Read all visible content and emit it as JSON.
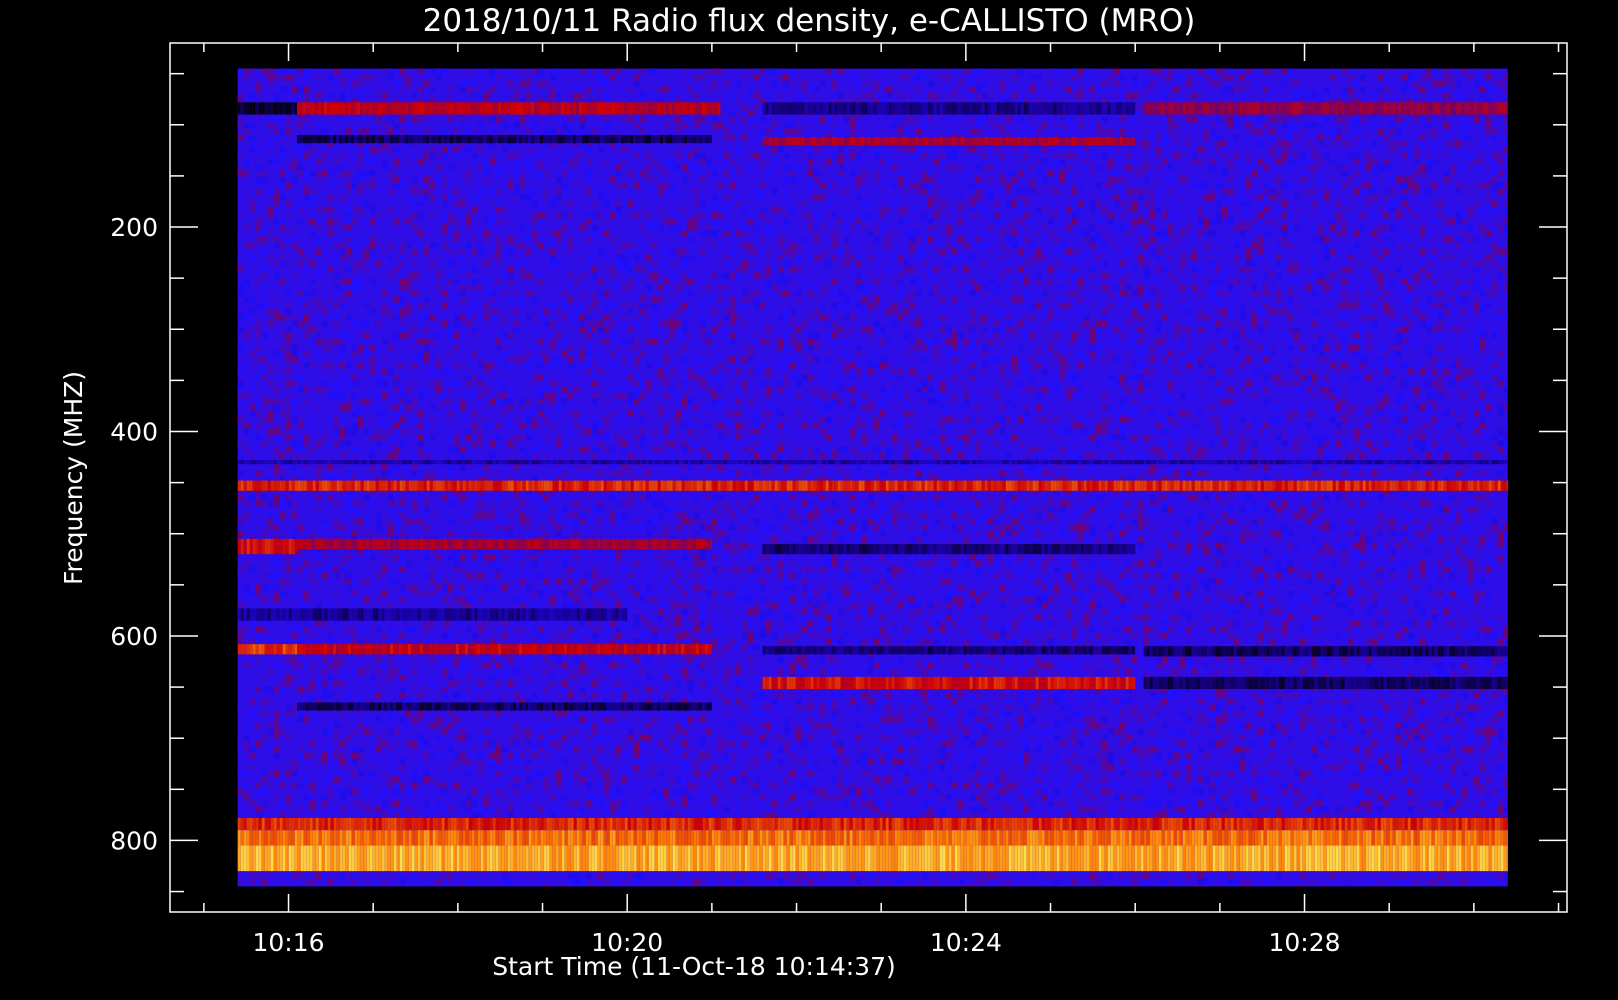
{
  "chart_data": {
    "type": "heatmap",
    "title": "2018/10/11  Radio flux density, e-CALLISTO (MRO)",
    "xlabel": "Start Time (11-Oct-18 10:14:37)",
    "ylabel": "Frequency (MHZ)",
    "x_tick_labels": [
      "10:16",
      "10:20",
      "10:24",
      "10:28"
    ],
    "x_tick_minutes": [
      16,
      20,
      24,
      28
    ],
    "x_range_minutes": [
      14.6,
      31.1
    ],
    "data_time_range_minutes": [
      15.4,
      30.4
    ],
    "y_tick_labels": [
      "200",
      "400",
      "600",
      "800"
    ],
    "y_tick_values": [
      200,
      400,
      600,
      800
    ],
    "y_range_mhz": [
      20,
      870
    ],
    "y_inverted": true,
    "data_freq_range_mhz": [
      45,
      845
    ],
    "colormap": [
      "#000000",
      "#1a00a0",
      "#2010ff",
      "#7a0060",
      "#d00000",
      "#ff7a00",
      "#ffff60"
    ],
    "background_level": 0.36,
    "bands": [
      {
        "f1": 78,
        "f2": 90,
        "t1": 15.4,
        "t2": 16.1,
        "level": 0.05
      },
      {
        "f1": 78,
        "f2": 90,
        "t1": 16.1,
        "t2": 21.1,
        "level": 0.62
      },
      {
        "f1": 78,
        "f2": 90,
        "t1": 21.6,
        "t2": 26.0,
        "level": 0.15
      },
      {
        "f1": 78,
        "f2": 90,
        "t1": 26.1,
        "t2": 30.4,
        "level": 0.55
      },
      {
        "f1": 110,
        "f2": 118,
        "t1": 16.1,
        "t2": 21.0,
        "level": 0.1
      },
      {
        "f1": 112,
        "f2": 120,
        "t1": 21.6,
        "t2": 26.0,
        "level": 0.6
      },
      {
        "f1": 448,
        "f2": 458,
        "t1": 15.4,
        "t2": 30.4,
        "level": 0.72
      },
      {
        "f1": 505,
        "f2": 520,
        "t1": 15.4,
        "t2": 16.1,
        "level": 0.68
      },
      {
        "f1": 505,
        "f2": 515,
        "t1": 16.1,
        "t2": 21.0,
        "level": 0.58
      },
      {
        "f1": 510,
        "f2": 520,
        "t1": 21.6,
        "t2": 26.0,
        "level": 0.12
      },
      {
        "f1": 608,
        "f2": 618,
        "t1": 15.4,
        "t2": 16.1,
        "level": 0.74
      },
      {
        "f1": 608,
        "f2": 618,
        "t1": 16.1,
        "t2": 21.0,
        "level": 0.64
      },
      {
        "f1": 610,
        "f2": 618,
        "t1": 21.6,
        "t2": 26.0,
        "level": 0.12
      },
      {
        "f1": 610,
        "f2": 620,
        "t1": 26.1,
        "t2": 30.4,
        "level": 0.1
      },
      {
        "f1": 640,
        "f2": 652,
        "t1": 21.6,
        "t2": 26.0,
        "level": 0.68
      },
      {
        "f1": 640,
        "f2": 652,
        "t1": 26.1,
        "t2": 30.4,
        "level": 0.1
      },
      {
        "f1": 665,
        "f2": 673,
        "t1": 16.1,
        "t2": 21.0,
        "level": 0.1
      },
      {
        "f1": 573,
        "f2": 585,
        "t1": 15.4,
        "t2": 20.0,
        "level": 0.16
      },
      {
        "f1": 428,
        "f2": 432,
        "t1": 15.4,
        "t2": 30.4,
        "level": 0.18
      },
      {
        "f1": 778,
        "f2": 790,
        "t1": 15.4,
        "t2": 30.4,
        "level": 0.72
      },
      {
        "f1": 790,
        "f2": 805,
        "t1": 15.4,
        "t2": 30.4,
        "level": 0.82
      },
      {
        "f1": 805,
        "f2": 830,
        "t1": 15.4,
        "t2": 30.4,
        "level": 0.9
      }
    ]
  }
}
